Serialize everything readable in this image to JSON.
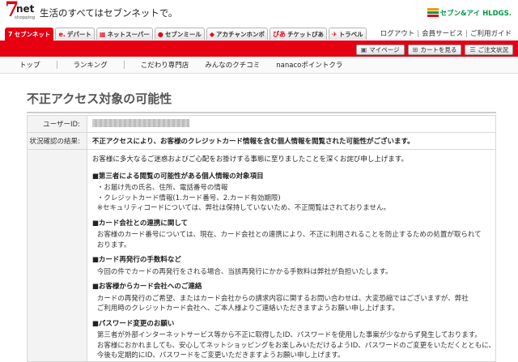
{
  "header": {
    "logo_main": "7",
    "logo_net": "net",
    "logo_sub": "shopping",
    "tagline": "生活のすべてはセブンネットで。",
    "holdings_text": "セブン&アイ HLDGS."
  },
  "tabs": [
    {
      "icon": "7",
      "label": "セブンネット",
      "active": true
    },
    {
      "icon": "e.",
      "label": "デパート",
      "active": false
    },
    {
      "icon": "▦",
      "label": "ネットスーパー",
      "active": false
    },
    {
      "icon": "●",
      "label": "セブンミール",
      "active": false
    },
    {
      "icon": "◆",
      "label": "アカチャンホンポ",
      "active": false
    },
    {
      "icon": "ぴあ",
      "label": "チケットぴあ",
      "active": false
    },
    {
      "icon": "✈",
      "label": "トラベル",
      "active": false
    }
  ],
  "util_links": [
    "ログアウト",
    "会員サービス",
    "ご利用ガイド"
  ],
  "redbar_buttons": [
    {
      "icon": "▣",
      "label": "マイページ"
    },
    {
      "icon": "⊞",
      "label": "カートを見る"
    },
    {
      "icon": "☰",
      "label": "ご注文状況"
    }
  ],
  "catnav": [
    "トップ",
    "ランキング",
    "こだわり専門店",
    "みんなのクチコミ",
    "nanacoポイントクラ"
  ],
  "page_title": "不正アクセス対象の可能性",
  "rows": {
    "user_id_label": "ユーザーID:",
    "status_label": "状況確認の結果:",
    "status_text": "不正アクセスにより、お客様のクレジットカード情報を含む個人情報を閲覧された可能性がございます。"
  },
  "intro": "お客様に多大なるご迷惑およびご心配をお掛けする事態に至りましたことを深くお詫び申し上げます。",
  "sections": [
    {
      "title": "■第三者による閲覧の可能性がある個人情報の対象項目",
      "lines": [
        "・お届け先の氏名、住所、電話番号の情報",
        "・クレジットカード情報(1.カード番号、2.カード有効期限)",
        "※セキュリティコードについては、弊社は保持していないため、不正閲覧はされておりません。"
      ]
    },
    {
      "title": "■カード会社との連携に関して",
      "lines": [
        "お客様のカード番号については、現在、カード会社との連携により、不正に利用されることを防止するための処置が取られて",
        "おります。"
      ]
    },
    {
      "title": "■カード再発行の手数料など",
      "lines": [
        "今回の件でカードの再発行をされる場合、当該再発行にかかる手数料は弊社が負担いたします。"
      ]
    },
    {
      "title": "■お客様からカード会社へのご連絡",
      "lines": [
        "カードの再発行のご希望、またはカード会社からの請求内容に関するお問い合わせは、大変恐縮ではございますが、弊社",
        "ご利用時のクレジットカード会社へ、ご本人様よりご連絡いただきますようお願い申し上げます。"
      ]
    },
    {
      "title": "■パスワード変更のお願い",
      "lines": [
        "第三者が外部インターネットサービス等から不正に取得したID、パスワードを使用した事案が少なからず発生しております。",
        "お客様におかれましても、安心してネットショッピングをお楽しみいただけるようID、パスワードのご変更をいただくとともに、",
        "今後も定期的にID、パスワードをご変更いただきますようお願い申し上げます。"
      ]
    }
  ]
}
